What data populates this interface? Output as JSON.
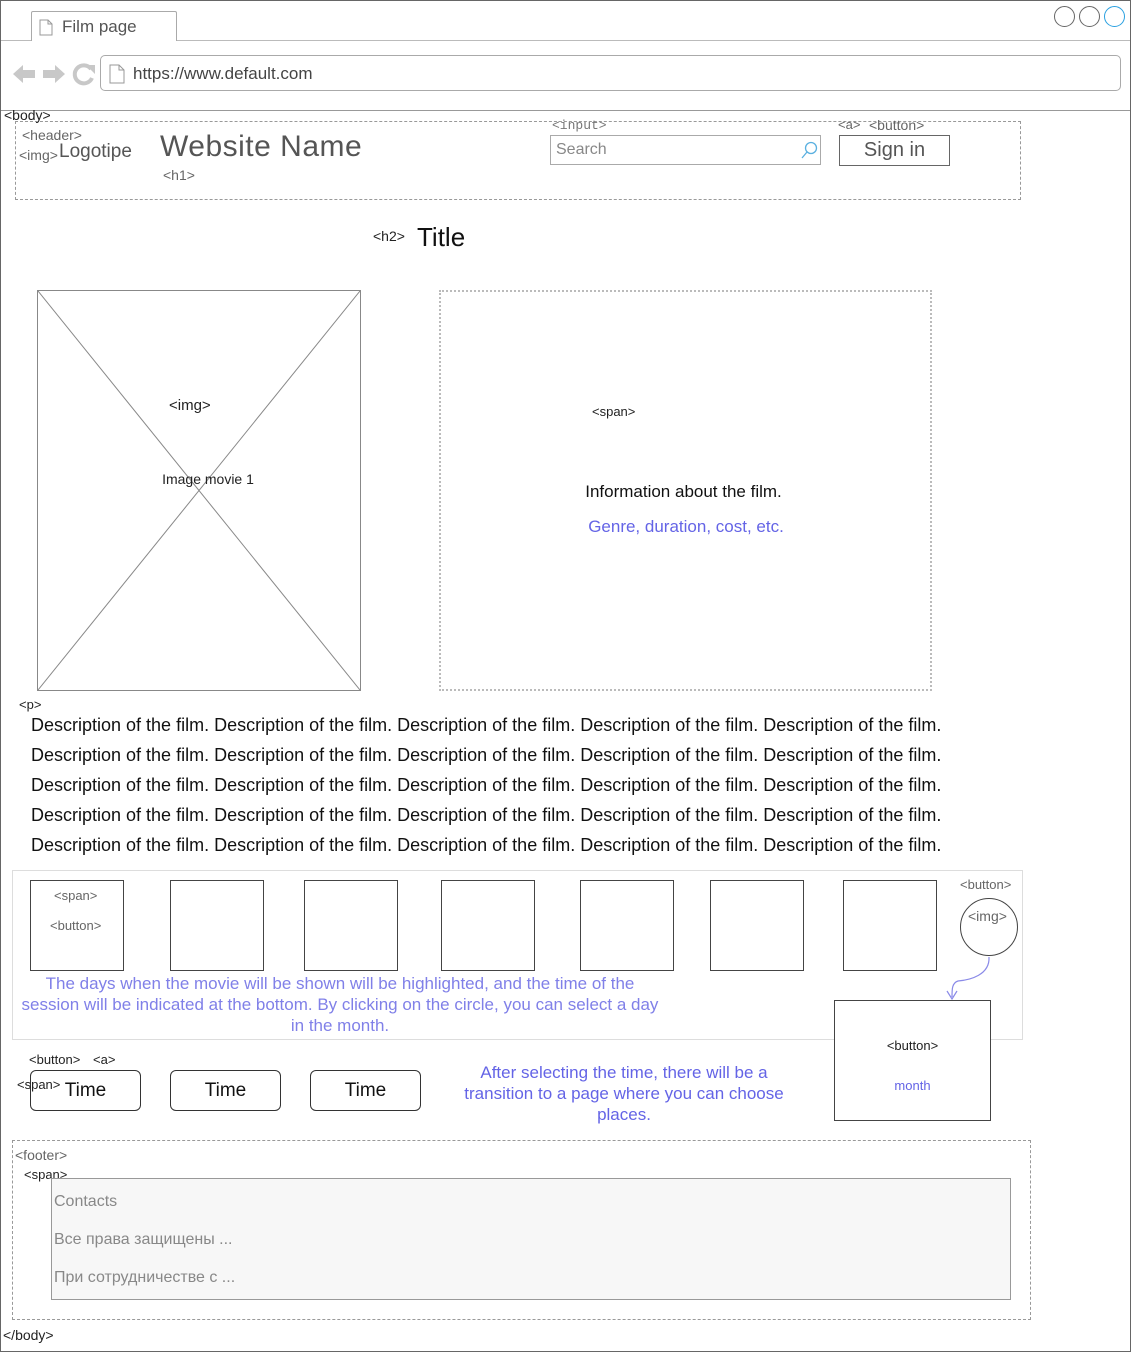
{
  "browser": {
    "tab_title": "Film page",
    "url": "https://www.default.com"
  },
  "tags": {
    "body_open": "<body>",
    "body_close": "</body>",
    "header": "<header>",
    "img": "<img>",
    "h1": "<h1>",
    "h2": "<h2>",
    "input": "<input>",
    "a": "<a>",
    "button": "<button>",
    "span": "<span>",
    "p": "<p>",
    "footer": "<footer>"
  },
  "header": {
    "logo": "Logotipe",
    "site_name": "Website Name",
    "search_placeholder": "Search",
    "sign_in": "Sign in"
  },
  "main": {
    "title": "Title",
    "poster_label": "Image movie 1",
    "info_text": "Information about the film.",
    "info_sub": "Genre, duration, cost, etc.",
    "description": "Description of the film. Description of the film. Description of the film. Description of the film. Description of the film. Description of the film. Description of the film. Description of the film. Description of the film. Description of the film. Description of the film. Description of the film. Description of the film. Description of the film. Description of the film. Description of the film. Description of the film. Description of the film. Description of the film. Description of the film. Description of the film. Description of the film. Description of the film. Description of the film. Description of the film."
  },
  "calendar": {
    "note": "The days when the movie will be shown will be highlighted, and the time of the session will be indicated at the bottom. By clicking on the circle, you can select a day in the month.",
    "month_label": "month"
  },
  "sessions": {
    "times": [
      "Time",
      "Time",
      "Time"
    ],
    "note": "After selecting the time, there will be a transition to a page where you can choose places."
  },
  "footer": {
    "contacts": "Contacts",
    "rights": "Все права защищены ...",
    "partner": "При сотрудничестве с ..."
  },
  "colors": {
    "annotation": "#6464e6",
    "annotation_light": "#8080e8"
  }
}
